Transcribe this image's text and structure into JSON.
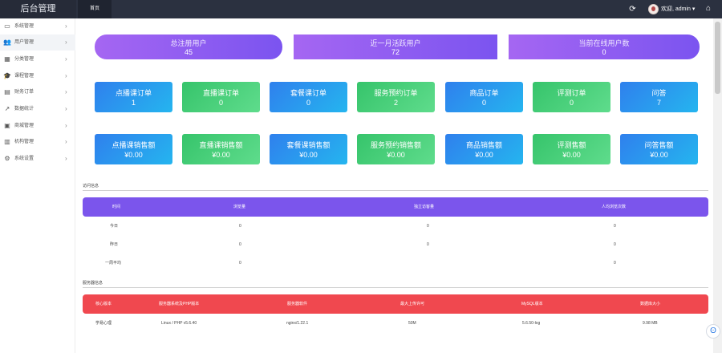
{
  "header": {
    "brand": "后台管理",
    "home_tab": "首页",
    "welcome": "欢迎, admin ▾",
    "icons": [
      "refresh-icon",
      "avatar",
      "home-icon"
    ]
  },
  "sidebar": {
    "items": [
      {
        "label": "系统管理",
        "icon": "monitor-icon"
      },
      {
        "label": "用户管理",
        "icon": "users-icon"
      },
      {
        "label": "分类管理",
        "icon": "grid-icon"
      },
      {
        "label": "课程管理",
        "icon": "graduation-cap-icon"
      },
      {
        "label": "财务订单",
        "icon": "wallet-icon"
      },
      {
        "label": "数据统计",
        "icon": "chart-icon"
      },
      {
        "label": "商城管理",
        "icon": "cart-icon"
      },
      {
        "label": "机构管理",
        "icon": "building-icon"
      },
      {
        "label": "系统设置",
        "icon": "gear-icon"
      }
    ]
  },
  "top_stats": [
    {
      "title": "总注册用户",
      "value": "45"
    },
    {
      "title": "近一月活跃用户",
      "value": "72"
    },
    {
      "title": "当前在线用户数",
      "value": "0"
    }
  ],
  "order_cards": [
    {
      "title": "点播课订单",
      "value": "1"
    },
    {
      "title": "直播课订单",
      "value": "0"
    },
    {
      "title": "套餐课订单",
      "value": "0"
    },
    {
      "title": "服务预约订单",
      "value": "2"
    },
    {
      "title": "商品订单",
      "value": "0"
    },
    {
      "title": "评测订单",
      "value": "0"
    },
    {
      "title": "问答",
      "value": "7"
    }
  ],
  "sales_cards": [
    {
      "title": "点播课销售额",
      "value": "¥0.00"
    },
    {
      "title": "直播课销售额",
      "value": "¥0.00"
    },
    {
      "title": "套餐课销售额",
      "value": "¥0.00"
    },
    {
      "title": "服务预约销售额",
      "value": "¥0.00"
    },
    {
      "title": "商品销售额",
      "value": "¥0.00"
    },
    {
      "title": "评测售额",
      "value": "¥0.00"
    },
    {
      "title": "问答售额",
      "value": "¥0.00"
    }
  ],
  "visit_section": {
    "title": "访问信息",
    "headers": [
      "时间",
      "浏览量",
      "独立访客量",
      "人均浏览次数"
    ],
    "rows": [
      [
        "今日",
        "0",
        "0",
        "0"
      ],
      [
        "昨日",
        "0",
        "0",
        "0"
      ],
      [
        "一周平均",
        "0",
        "",
        "0"
      ]
    ]
  },
  "server_section": {
    "title": "服务器信息",
    "headers": [
      "核心版本",
      "服务器系统及PHP版本",
      "服务器软件",
      "最大上传许可",
      "MySQL版本",
      "数据库大小"
    ],
    "row": [
      "学易心理",
      "Linux / PHP v5.6.40",
      "nginx/1.22.1",
      "50M",
      "5.6.50-log",
      "9.98 MB"
    ]
  },
  "colors": {
    "topbar": "#2b3140",
    "purple": "#7b55ec",
    "blue": "#2f80ed",
    "green": "#36c46b",
    "red": "#f0484f"
  }
}
